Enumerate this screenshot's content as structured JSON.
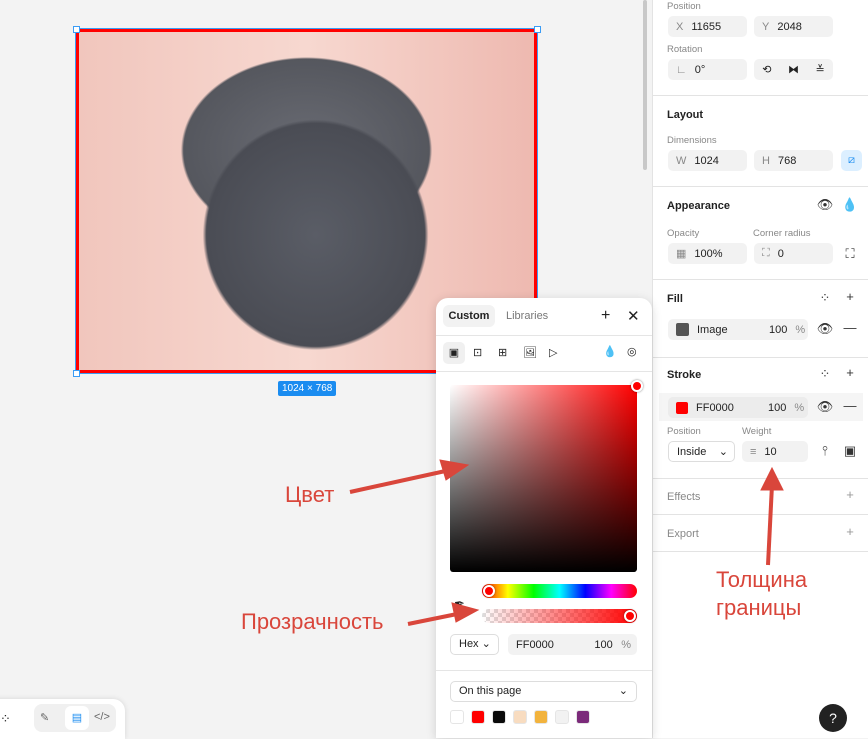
{
  "canvas": {
    "dimensions_label": "1024 × 768"
  },
  "panel": {
    "position_label": "Position",
    "x_prefix": "X",
    "x": "11655",
    "y_prefix": "Y",
    "y": "2048",
    "rotation_label": "Rotation",
    "rotation": "0°",
    "layout_title": "Layout",
    "dimensions_label": "Dimensions",
    "w_prefix": "W",
    "w": "1024",
    "h_prefix": "H",
    "h": "768",
    "appearance_title": "Appearance",
    "opacity_label": "Opacity",
    "opacity": "100%",
    "corner_label": "Corner radius",
    "corner": "0",
    "fill_title": "Fill",
    "fill_name": "Image",
    "fill_opacity": "100",
    "pct": "%",
    "stroke_title": "Stroke",
    "stroke_color": "FF0000",
    "stroke_opacity": "100",
    "stroke_position_label": "Position",
    "stroke_position": "Inside",
    "weight_label": "Weight",
    "weight": "10",
    "effects_title": "Effects",
    "export_title": "Export"
  },
  "picker": {
    "tab_custom": "Custom",
    "tab_libraries": "Libraries",
    "format": "Hex",
    "hex": "FF0000",
    "opacity": "100",
    "pct": "%",
    "library_select": "On this page",
    "swatches": [
      "#ffffff",
      "#ff0000",
      "#0a0a0a",
      "#f8dcc0",
      "#f2b33d",
      "#f2f2f2",
      "#7b2a7a"
    ]
  },
  "annotations": {
    "color": "Цвет",
    "opacity": "Прозрачность",
    "weight_line1": "Толщина",
    "weight_line2": "границы"
  },
  "help": "?"
}
